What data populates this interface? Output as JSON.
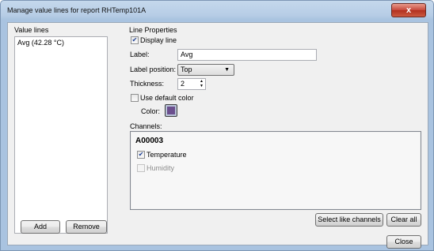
{
  "window": {
    "title": "Manage value lines for report RHTemp101A",
    "close_glyph": "x"
  },
  "left_panel": {
    "heading": "Value lines",
    "items": [
      "Avg (42.28 °C)"
    ],
    "add_label": "Add",
    "remove_label": "Remove"
  },
  "properties": {
    "heading": "Line Properties",
    "display_line_label": "Display line",
    "display_line_checked": true,
    "label_caption": "Label:",
    "label_value": "Avg",
    "label_position_caption": "Label position:",
    "label_position_value": "Top",
    "thickness_caption": "Thickness:",
    "thickness_value": "2",
    "use_default_color_label": "Use default color",
    "use_default_color_checked": false,
    "color_caption": "Color:",
    "color_value": "#6b4f8e"
  },
  "channels": {
    "heading": "Channels:",
    "device": "A00003",
    "items": [
      {
        "label": "Temperature",
        "checked": true,
        "enabled": true
      },
      {
        "label": "Humidity",
        "checked": false,
        "enabled": false
      }
    ],
    "select_like_label": "Select like channels",
    "clear_all_label": "Clear all"
  },
  "footer": {
    "close_label": "Close"
  },
  "icons": {
    "checkmark": "✔",
    "dropdown": "▼",
    "spin_up": "▲",
    "spin_down": "▼"
  }
}
